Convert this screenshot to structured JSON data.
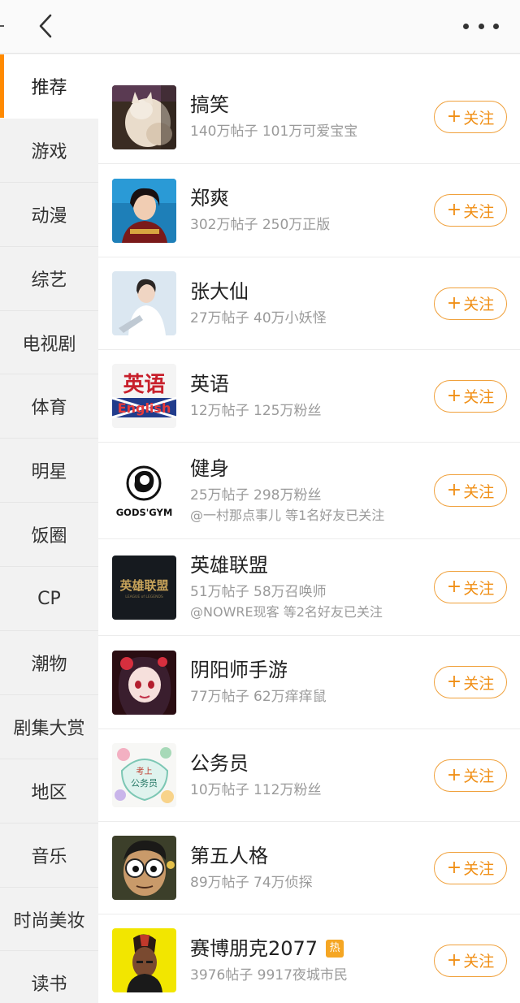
{
  "header": {
    "back_icon": "chevron-left-icon",
    "more_icon": "more-horizontal-icon"
  },
  "sidebar": {
    "accent": "#ff8a00",
    "items": [
      {
        "label": "推荐",
        "active": true
      },
      {
        "label": "游戏"
      },
      {
        "label": "动漫"
      },
      {
        "label": "综艺"
      },
      {
        "label": "电视剧"
      },
      {
        "label": "体育"
      },
      {
        "label": "明星"
      },
      {
        "label": "饭圈"
      },
      {
        "label": "CP"
      },
      {
        "label": "潮物"
      },
      {
        "label": "剧集大赏"
      },
      {
        "label": "地区"
      },
      {
        "label": "音乐"
      },
      {
        "label": "时尚美妆"
      },
      {
        "label": "读书"
      }
    ]
  },
  "follow_button": {
    "plus": "+",
    "label": "关注",
    "color": "#f08f16"
  },
  "groups": [
    {
      "name": "搞笑",
      "stats": "140万帖子 101万可爱宝宝",
      "thumb_icon": "cat-photo"
    },
    {
      "name": "郑爽",
      "stats": "302万帖子 250万正版",
      "thumb_icon": "portrait-photo"
    },
    {
      "name": "张大仙",
      "stats": "27万帖子 40万小妖怪",
      "thumb_icon": "portrait-photo"
    },
    {
      "name": "英语",
      "stats": "12万帖子 125万粉丝",
      "thumb_icon": "english-logo",
      "thumb_text": {
        "cn": "英语",
        "en": "English"
      }
    },
    {
      "name": "健身",
      "stats": "25万帖子 298万粉丝",
      "friends": "@一村那点事儿 等1名好友已关注",
      "thumb_icon": "gym-logo",
      "thumb_text": {
        "brand": "GODS'GYM"
      }
    },
    {
      "name": "英雄联盟",
      "stats": "51万帖子 58万召唤师",
      "friends": "@NOWRE现客 等2名好友已关注",
      "thumb_icon": "lol-logo",
      "thumb_text": {
        "cn": "英雄联盟",
        "en": "LEAGUE of LEGENDS"
      }
    },
    {
      "name": "阴阳师手游",
      "stats": "77万帖子 62万痒痒鼠",
      "thumb_icon": "anime-girl-art"
    },
    {
      "name": "公务员",
      "stats": "10万帖子 112万粉丝",
      "thumb_icon": "exam-badge",
      "thumb_text": {
        "line1": "考上",
        "line2": "公务员"
      }
    },
    {
      "name": "第五人格",
      "stats": "89万帖子 74万侦探",
      "thumb_icon": "cartoon-character-art"
    },
    {
      "name": "赛博朋克2077",
      "stats": "3976帖子 9917夜城市民",
      "hot": "热",
      "thumb_icon": "cyberpunk-character-art"
    }
  ]
}
